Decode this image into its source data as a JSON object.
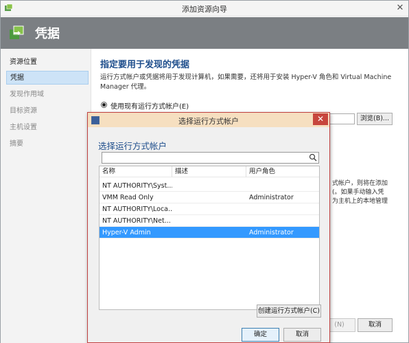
{
  "window": {
    "title": "添加资源向导"
  },
  "header": {
    "title": "凭据"
  },
  "nav": {
    "items": [
      {
        "label": "资源位置",
        "state": "done"
      },
      {
        "label": "凭据",
        "state": "active"
      },
      {
        "label": "发现作用域",
        "state": "pending"
      },
      {
        "label": "目标资源",
        "state": "pending"
      },
      {
        "label": "主机设置",
        "state": "pending"
      },
      {
        "label": "摘要",
        "state": "pending"
      }
    ]
  },
  "main": {
    "heading": "指定要用于发现的凭据",
    "desc_line1": "运行方式帐户或凭据将用于发现计算机，如果需要，还将用于安装 Hyper-V 角色和 Virtual Machine",
    "desc_line2": "Manager 代理。",
    "radio_label": "使用现有运行方式帐户(E)",
    "browse_label": "浏览(B)...",
    "partial_text": [
      "式帐户，则将在添加",
      "(。如果手动输入凭",
      "为主机上的本地管理"
    ],
    "next_label": "(N)",
    "cancel_label": "取消"
  },
  "dialog": {
    "title": "选择运行方式帐户",
    "heading": "选择运行方式帐户",
    "search": {
      "value": "",
      "icon": "search-icon"
    },
    "columns": [
      "名称",
      "描述",
      "用户角色"
    ],
    "rows": [
      {
        "name": "NT AUTHORITY\\Syst...",
        "desc": "",
        "role": ""
      },
      {
        "name": "VMM Read Only",
        "desc": "",
        "role": "Administrator"
      },
      {
        "name": "NT AUTHORITY\\Loca...",
        "desc": "",
        "role": ""
      },
      {
        "name": "NT AUTHORITY\\Net...",
        "desc": "",
        "role": ""
      },
      {
        "name": "Hyper-V Admin",
        "desc": "",
        "role": "Administrator",
        "selected": true
      }
    ],
    "create_label": "创建运行方式帐户(C)",
    "ok_label": "确定",
    "cancel_label": "取消"
  },
  "colors": {
    "accent": "#1e4e8c",
    "selection": "#3399ff",
    "header_bg": "#7b7f83",
    "dialog_close": "#c7463d"
  }
}
